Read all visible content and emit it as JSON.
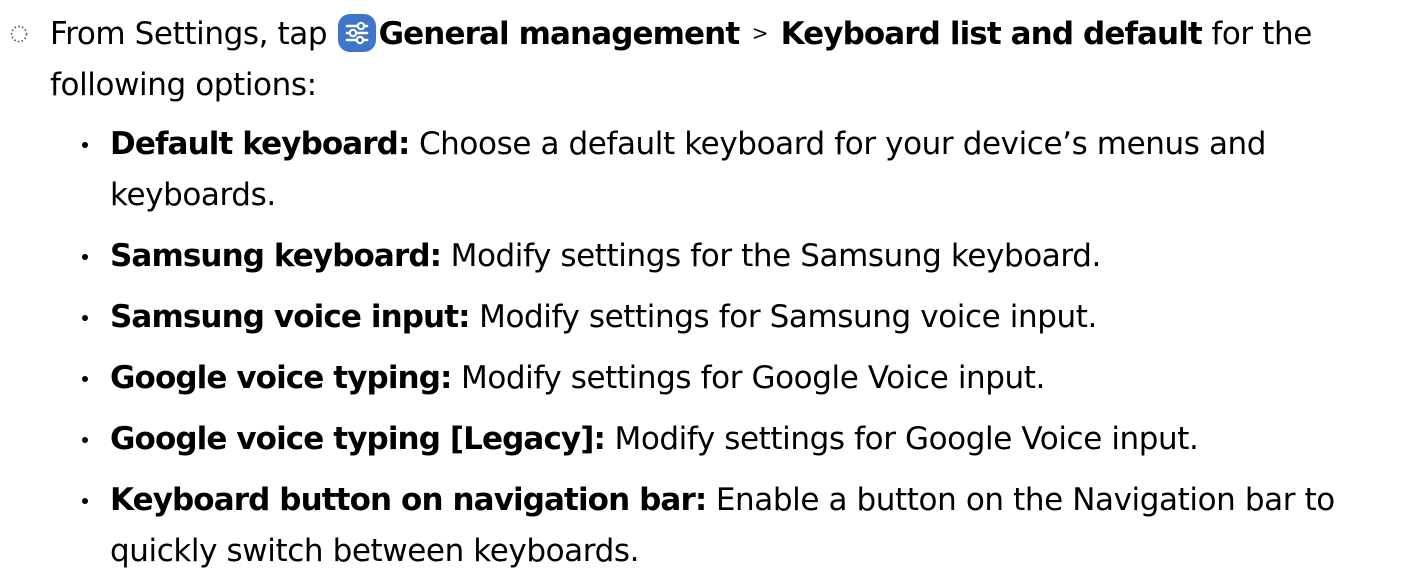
{
  "colors": {
    "text": "#000000",
    "settings_icon_bg": "#3f76c9",
    "settings_icon_fg": "#ffffff"
  },
  "step": {
    "marker_icon": "step-circle-icon",
    "lead_text": "From Settings, tap",
    "settings_icon": "settings-sliders-icon",
    "path_first": "General management",
    "separator": ">",
    "path_second": "Keyboard list and default",
    "tail_text": "for the following options:"
  },
  "options": [
    {
      "term": "Default keyboard:",
      "description": "Choose a default keyboard for your device’s menus and keyboards."
    },
    {
      "term": "Samsung keyboard:",
      "description": "Modify settings for the Samsung keyboard."
    },
    {
      "term": "Samsung voice input:",
      "description": "Modify settings for Samsung voice input."
    },
    {
      "term": "Google voice typing:",
      "description": "Modify settings for Google Voice input."
    },
    {
      "term": "Google voice typing [Legacy]:",
      "description": "Modify settings for Google Voice input."
    },
    {
      "term": "Keyboard button on navigation bar:",
      "description": "Enable a button on the Navigation bar to quickly switch between keyboards."
    }
  ]
}
